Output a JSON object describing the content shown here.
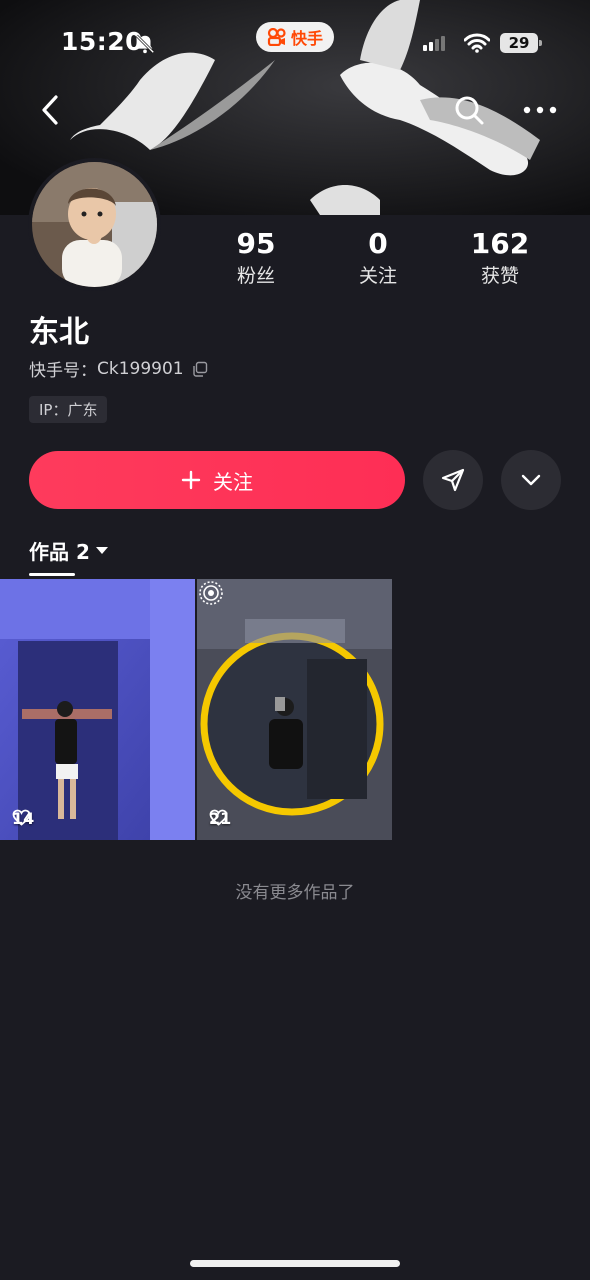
{
  "status_bar": {
    "time": "15:20",
    "battery": "29",
    "app_name": "快手"
  },
  "profile": {
    "name": "东北",
    "id_label": "快手号：",
    "id_value": "Ck199901",
    "ip_label": "IP：广东",
    "stats": [
      {
        "value": "95",
        "label": "粉丝"
      },
      {
        "value": "0",
        "label": "关注"
      },
      {
        "value": "162",
        "label": "获赞"
      }
    ]
  },
  "actions": {
    "follow_label": "关注"
  },
  "works": {
    "tab_label": "作品 2",
    "items": [
      {
        "likes": "14"
      },
      {
        "likes": "21"
      }
    ],
    "end_text": "没有更多作品了"
  },
  "colors": {
    "accent": "#fe2e55",
    "background": "#1b1b22",
    "brand": "#ff4906"
  },
  "icons": [
    "bell-muted-icon",
    "signal-icon",
    "wifi-icon",
    "back-icon",
    "search-icon",
    "more-icon",
    "copy-icon",
    "plus-icon",
    "share-icon",
    "chevron-down-icon",
    "heart-icon",
    "live-icon"
  ]
}
